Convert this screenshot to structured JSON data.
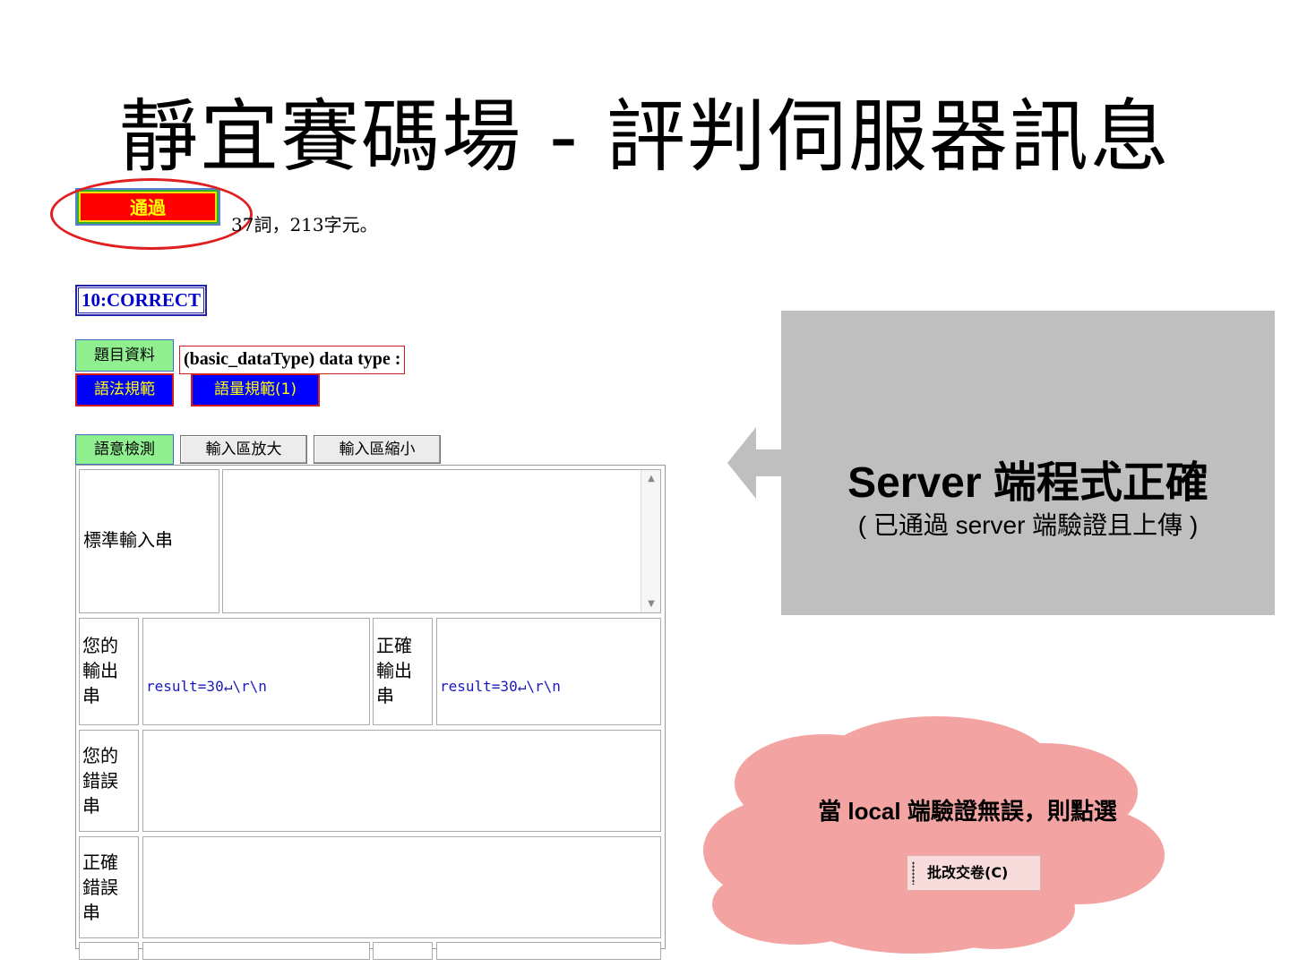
{
  "slide": {
    "title": "靜宜賽碼場 - 評判伺服器訊息"
  },
  "result": {
    "pass_label": "通過",
    "stats": "37詞，213字元。",
    "status_badge": "10:CORRECT"
  },
  "problem": {
    "info_label": "題目資料",
    "title": "(basic_dataType) data type :",
    "syntax_label": "語法規範",
    "quantity_label": "語量規範(1)"
  },
  "toolbar": {
    "semantic_check": "語意檢測",
    "enlarge_input": "輸入區放大",
    "shrink_input": "輸入區縮小"
  },
  "io_table": {
    "stdin_label": "標準輸入串",
    "stdin_value": "",
    "your_output_label": "您的輸出串",
    "your_output_value": "result=30↵\\r\\n",
    "correct_output_label": "正確輸出串",
    "correct_output_value": "result=30↵\\r\\n",
    "your_error_label": "您的錯誤串",
    "correct_error_label": "正確錯誤串"
  },
  "callout": {
    "main": "Server 端程式正確",
    "sub": "( 已通過 server 端驗證且上傳 )"
  },
  "cloud": {
    "text": "當 local 端驗證無誤，則點選",
    "submit_label": "批改交卷(C)"
  },
  "colors": {
    "callout_gray": "#bfbfbf",
    "cloud_pink": "#f4a3a3",
    "pass_red": "#ff0000",
    "highlight_ellipse": "#e02020",
    "badge_blue": "#0000ff",
    "label_green": "#90f090"
  }
}
